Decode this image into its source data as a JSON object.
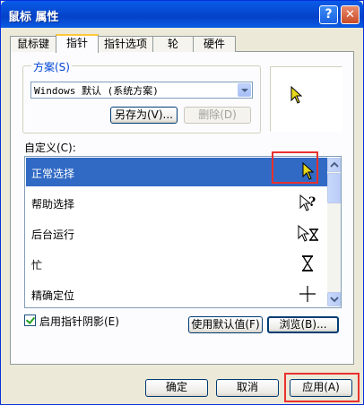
{
  "window": {
    "title": "鼠标 属性",
    "help_glyph": "?",
    "close_glyph": "✕"
  },
  "tabs": [
    {
      "label": "鼠标键"
    },
    {
      "label": "指针",
      "active": true
    },
    {
      "label": "指针选项"
    },
    {
      "label": "轮"
    },
    {
      "label": "硬件"
    }
  ],
  "scheme": {
    "legend": "方案(S)",
    "selected": "Windows 默认 (系统方案)",
    "save_as_label": "另存为(V)...",
    "delete_label": "删除(D)"
  },
  "customize": {
    "label": "自定义(C):",
    "items": [
      {
        "name": "正常选择",
        "icon": "arrow-cursor-icon",
        "selected": true
      },
      {
        "name": "帮助选择",
        "icon": "help-cursor-icon"
      },
      {
        "name": "后台运行",
        "icon": "working-in-background-cursor-icon"
      },
      {
        "name": "忙",
        "icon": "busy-hourglass-cursor-icon"
      },
      {
        "name": "精确定位",
        "icon": "crosshair-cursor-icon"
      }
    ]
  },
  "shadow": {
    "label": "启用指针阴影(E)",
    "checked": true
  },
  "buttons": {
    "use_default": "使用默认值(F)",
    "browse": "浏览(B)...",
    "ok": "确定",
    "cancel": "取消",
    "apply": "应用(A)"
  },
  "colors": {
    "title_bar": "#0A5BE8",
    "selection": "#316AC5",
    "highlight": "#E8312E"
  }
}
